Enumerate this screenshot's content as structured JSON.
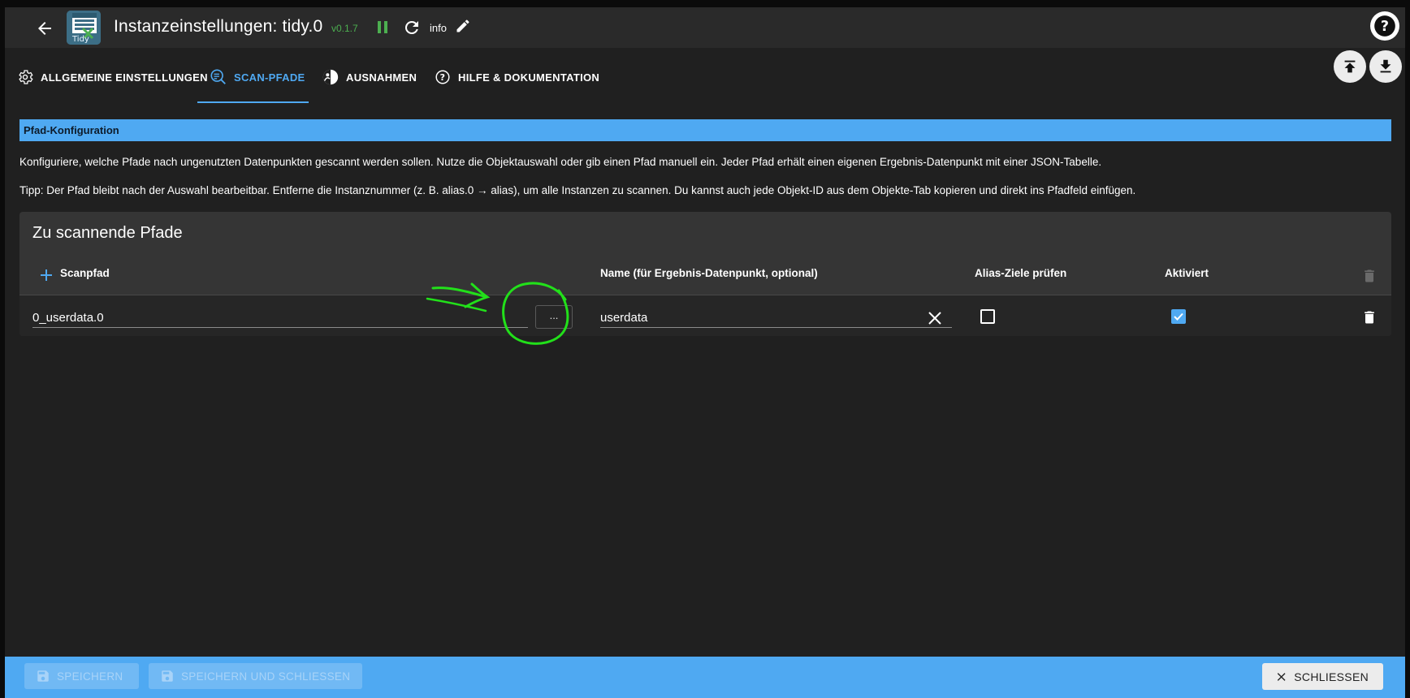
{
  "header": {
    "title": "Instanzeinstellungen: tidy.0",
    "version": "v0.1.7",
    "info_label": "info",
    "logo_text": "Tidy"
  },
  "tabs": [
    {
      "label": "ALLGEMEINE EINSTELLUNGEN",
      "icon": "gear-icon"
    },
    {
      "label": "SCAN-PFADE",
      "icon": "search-list-icon",
      "active": true
    },
    {
      "label": "AUSNAHMEN",
      "icon": "person-icon"
    },
    {
      "label": "HILFE & DOKUMENTATION",
      "icon": "help-circle-icon"
    }
  ],
  "section": {
    "header": "Pfad-Konfiguration",
    "description": "Konfiguriere, welche Pfade nach ungenutzten Datenpunkten gescannt werden sollen. Nutze die Objektauswahl oder gib einen Pfad manuell ein. Jeder Pfad erhält einen eigenen Ergebnis-Datenpunkt mit einer JSON-Tabelle.",
    "tip": "Tipp: Der Pfad bleibt nach der Auswahl bearbeitbar. Entferne die Instanznummer (z. B. alias.0 → alias), um alle Instanzen zu scannen. Du kannst auch jede Objekt-ID aus dem Objekte-Tab kopieren und direkt ins Pfadfeld einfügen."
  },
  "table": {
    "title": "Zu scannende Pfade",
    "columns": [
      "Scanpfad",
      "Name (für Ergebnis-Datenpunkt, optional)",
      "Alias-Ziele prüfen",
      "Aktiviert"
    ],
    "rows": [
      {
        "scanpfad": "0_userdata.0",
        "picker_label": "...",
        "name": "userdata",
        "alias_ziele_pruefen": false,
        "aktiviert": true
      }
    ]
  },
  "footer": {
    "save_label": "SPEICHERN",
    "save_close_label": "SPEICHERN UND SCHLIESSEN",
    "close_label": "SCHLIESSEN"
  },
  "colors": {
    "accent": "#4fa9f2",
    "background": "#202020",
    "version": "#4caf50",
    "annotation": "#22e01a"
  }
}
